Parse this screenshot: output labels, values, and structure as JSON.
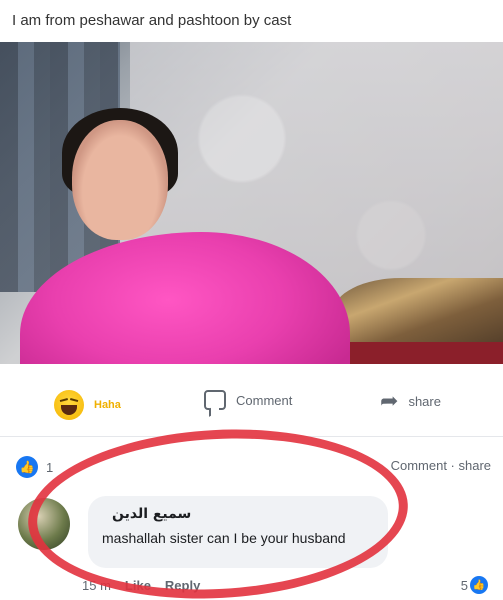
{
  "post": {
    "text": "I am from peshawar and pashtoon by cast"
  },
  "actions": {
    "haha_label": "Haha",
    "comment_label": "Comment",
    "share_label": "share"
  },
  "engagement": {
    "like_count": "1",
    "comment_share_meta": "Comment · share"
  },
  "comment": {
    "author": "سميع الدين",
    "text": "mashallah sister can I be your husband",
    "time": "15 m",
    "like_label": "Like",
    "reply_label": "Reply",
    "reaction_count": "5"
  },
  "colors": {
    "annotation_circle": "#e2323e",
    "like_blue": "#1877f2",
    "haha_yellow": "#f5b400"
  }
}
